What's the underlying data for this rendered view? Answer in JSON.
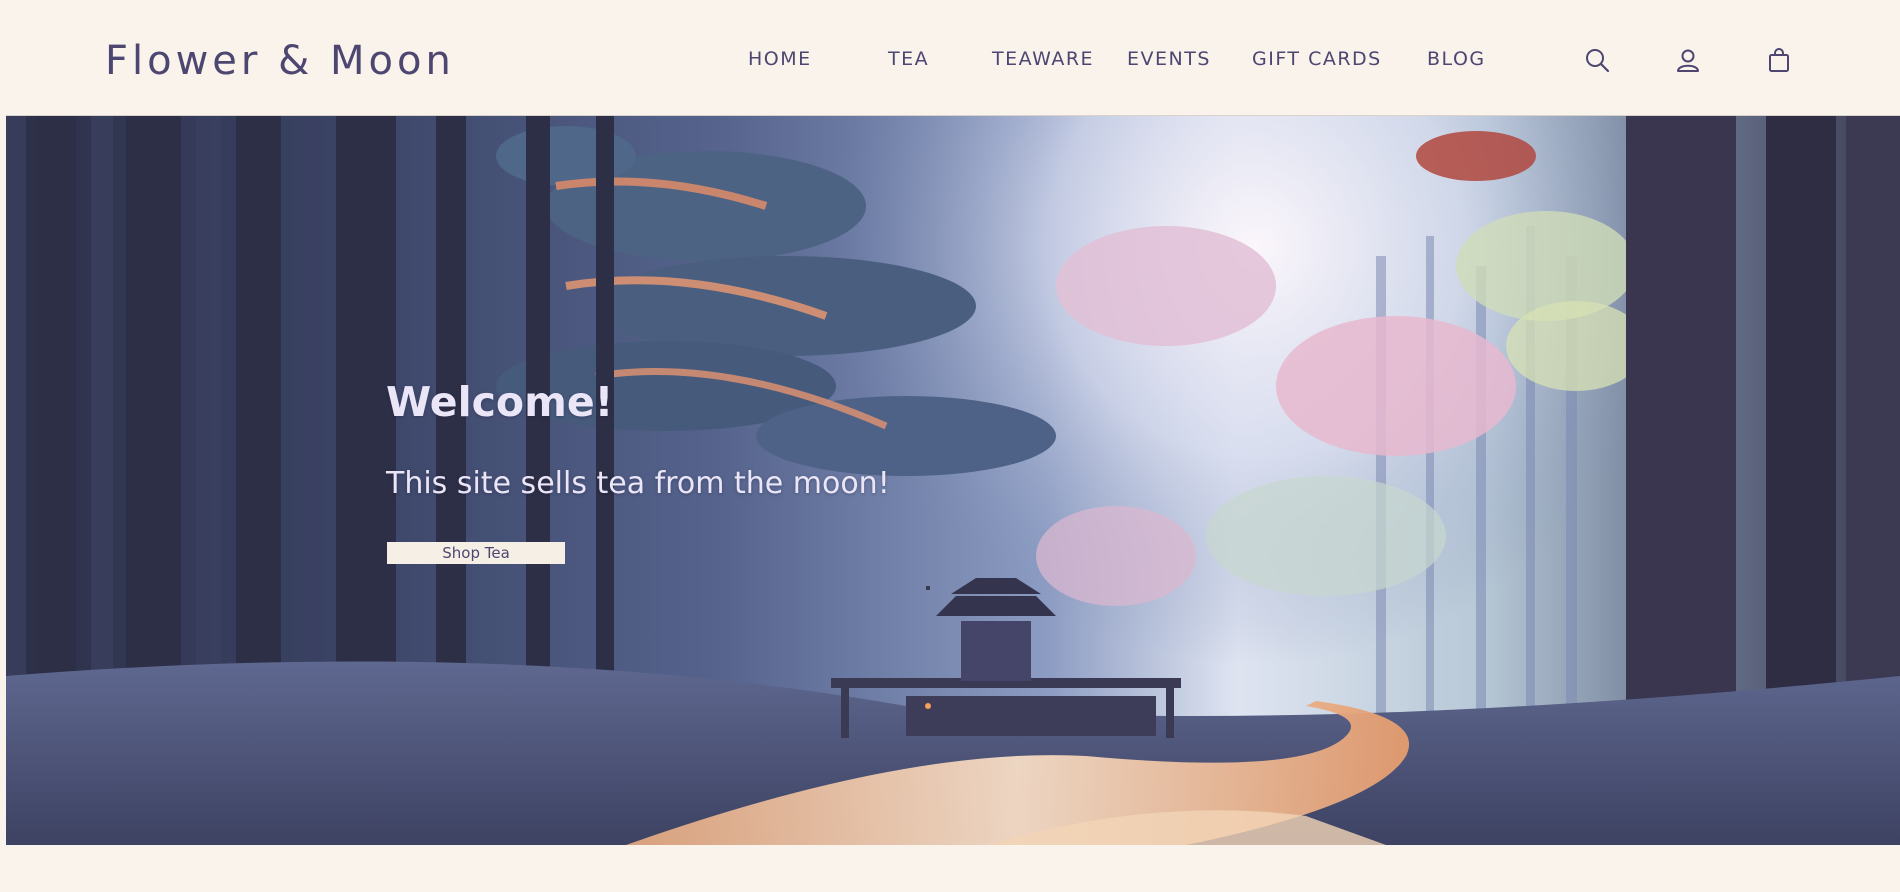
{
  "brand": {
    "logo": "Flower & Moon"
  },
  "nav": [
    {
      "label": "HOME"
    },
    {
      "label": "TEA"
    },
    {
      "label": "TEAWARE"
    },
    {
      "label": "EVENTS"
    },
    {
      "label": "GIFT CARDS"
    },
    {
      "label": "BLOG"
    }
  ],
  "header_icons": [
    "search-icon",
    "account-icon",
    "shopping-bag-icon"
  ],
  "hero": {
    "title": "Welcome!",
    "subtitle": "This site sells tea from the moon!",
    "cta_label": "Shop Tea"
  },
  "colors": {
    "page_background": "#f9f3ec",
    "brand_text": "#4c4671",
    "hero_text": "#ebe6f7",
    "button_background": "#f6efe6"
  }
}
